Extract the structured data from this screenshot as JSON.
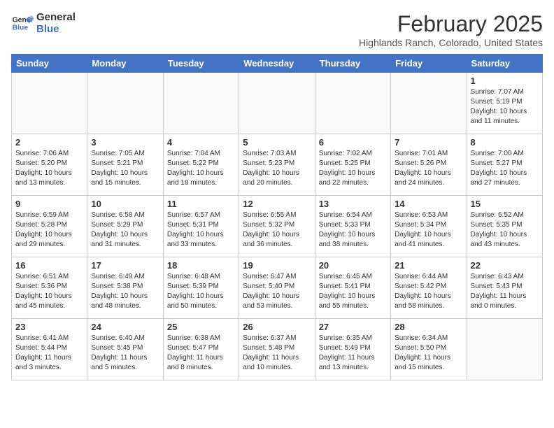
{
  "logo": {
    "line1": "General",
    "line2": "Blue"
  },
  "title": "February 2025",
  "subtitle": "Highlands Ranch, Colorado, United States",
  "weekdays": [
    "Sunday",
    "Monday",
    "Tuesday",
    "Wednesday",
    "Thursday",
    "Friday",
    "Saturday"
  ],
  "weeks": [
    [
      {
        "day": "",
        "info": ""
      },
      {
        "day": "",
        "info": ""
      },
      {
        "day": "",
        "info": ""
      },
      {
        "day": "",
        "info": ""
      },
      {
        "day": "",
        "info": ""
      },
      {
        "day": "",
        "info": ""
      },
      {
        "day": "1",
        "info": "Sunrise: 7:07 AM\nSunset: 5:19 PM\nDaylight: 10 hours\nand 11 minutes."
      }
    ],
    [
      {
        "day": "2",
        "info": "Sunrise: 7:06 AM\nSunset: 5:20 PM\nDaylight: 10 hours\nand 13 minutes."
      },
      {
        "day": "3",
        "info": "Sunrise: 7:05 AM\nSunset: 5:21 PM\nDaylight: 10 hours\nand 15 minutes."
      },
      {
        "day": "4",
        "info": "Sunrise: 7:04 AM\nSunset: 5:22 PM\nDaylight: 10 hours\nand 18 minutes."
      },
      {
        "day": "5",
        "info": "Sunrise: 7:03 AM\nSunset: 5:23 PM\nDaylight: 10 hours\nand 20 minutes."
      },
      {
        "day": "6",
        "info": "Sunrise: 7:02 AM\nSunset: 5:25 PM\nDaylight: 10 hours\nand 22 minutes."
      },
      {
        "day": "7",
        "info": "Sunrise: 7:01 AM\nSunset: 5:26 PM\nDaylight: 10 hours\nand 24 minutes."
      },
      {
        "day": "8",
        "info": "Sunrise: 7:00 AM\nSunset: 5:27 PM\nDaylight: 10 hours\nand 27 minutes."
      }
    ],
    [
      {
        "day": "9",
        "info": "Sunrise: 6:59 AM\nSunset: 5:28 PM\nDaylight: 10 hours\nand 29 minutes."
      },
      {
        "day": "10",
        "info": "Sunrise: 6:58 AM\nSunset: 5:29 PM\nDaylight: 10 hours\nand 31 minutes."
      },
      {
        "day": "11",
        "info": "Sunrise: 6:57 AM\nSunset: 5:31 PM\nDaylight: 10 hours\nand 33 minutes."
      },
      {
        "day": "12",
        "info": "Sunrise: 6:55 AM\nSunset: 5:32 PM\nDaylight: 10 hours\nand 36 minutes."
      },
      {
        "day": "13",
        "info": "Sunrise: 6:54 AM\nSunset: 5:33 PM\nDaylight: 10 hours\nand 38 minutes."
      },
      {
        "day": "14",
        "info": "Sunrise: 6:53 AM\nSunset: 5:34 PM\nDaylight: 10 hours\nand 41 minutes."
      },
      {
        "day": "15",
        "info": "Sunrise: 6:52 AM\nSunset: 5:35 PM\nDaylight: 10 hours\nand 43 minutes."
      }
    ],
    [
      {
        "day": "16",
        "info": "Sunrise: 6:51 AM\nSunset: 5:36 PM\nDaylight: 10 hours\nand 45 minutes."
      },
      {
        "day": "17",
        "info": "Sunrise: 6:49 AM\nSunset: 5:38 PM\nDaylight: 10 hours\nand 48 minutes."
      },
      {
        "day": "18",
        "info": "Sunrise: 6:48 AM\nSunset: 5:39 PM\nDaylight: 10 hours\nand 50 minutes."
      },
      {
        "day": "19",
        "info": "Sunrise: 6:47 AM\nSunset: 5:40 PM\nDaylight: 10 hours\nand 53 minutes."
      },
      {
        "day": "20",
        "info": "Sunrise: 6:45 AM\nSunset: 5:41 PM\nDaylight: 10 hours\nand 55 minutes."
      },
      {
        "day": "21",
        "info": "Sunrise: 6:44 AM\nSunset: 5:42 PM\nDaylight: 10 hours\nand 58 minutes."
      },
      {
        "day": "22",
        "info": "Sunrise: 6:43 AM\nSunset: 5:43 PM\nDaylight: 11 hours\nand 0 minutes."
      }
    ],
    [
      {
        "day": "23",
        "info": "Sunrise: 6:41 AM\nSunset: 5:44 PM\nDaylight: 11 hours\nand 3 minutes."
      },
      {
        "day": "24",
        "info": "Sunrise: 6:40 AM\nSunset: 5:45 PM\nDaylight: 11 hours\nand 5 minutes."
      },
      {
        "day": "25",
        "info": "Sunrise: 6:38 AM\nSunset: 5:47 PM\nDaylight: 11 hours\nand 8 minutes."
      },
      {
        "day": "26",
        "info": "Sunrise: 6:37 AM\nSunset: 5:48 PM\nDaylight: 11 hours\nand 10 minutes."
      },
      {
        "day": "27",
        "info": "Sunrise: 6:35 AM\nSunset: 5:49 PM\nDaylight: 11 hours\nand 13 minutes."
      },
      {
        "day": "28",
        "info": "Sunrise: 6:34 AM\nSunset: 5:50 PM\nDaylight: 11 hours\nand 15 minutes."
      },
      {
        "day": "",
        "info": ""
      }
    ]
  ]
}
